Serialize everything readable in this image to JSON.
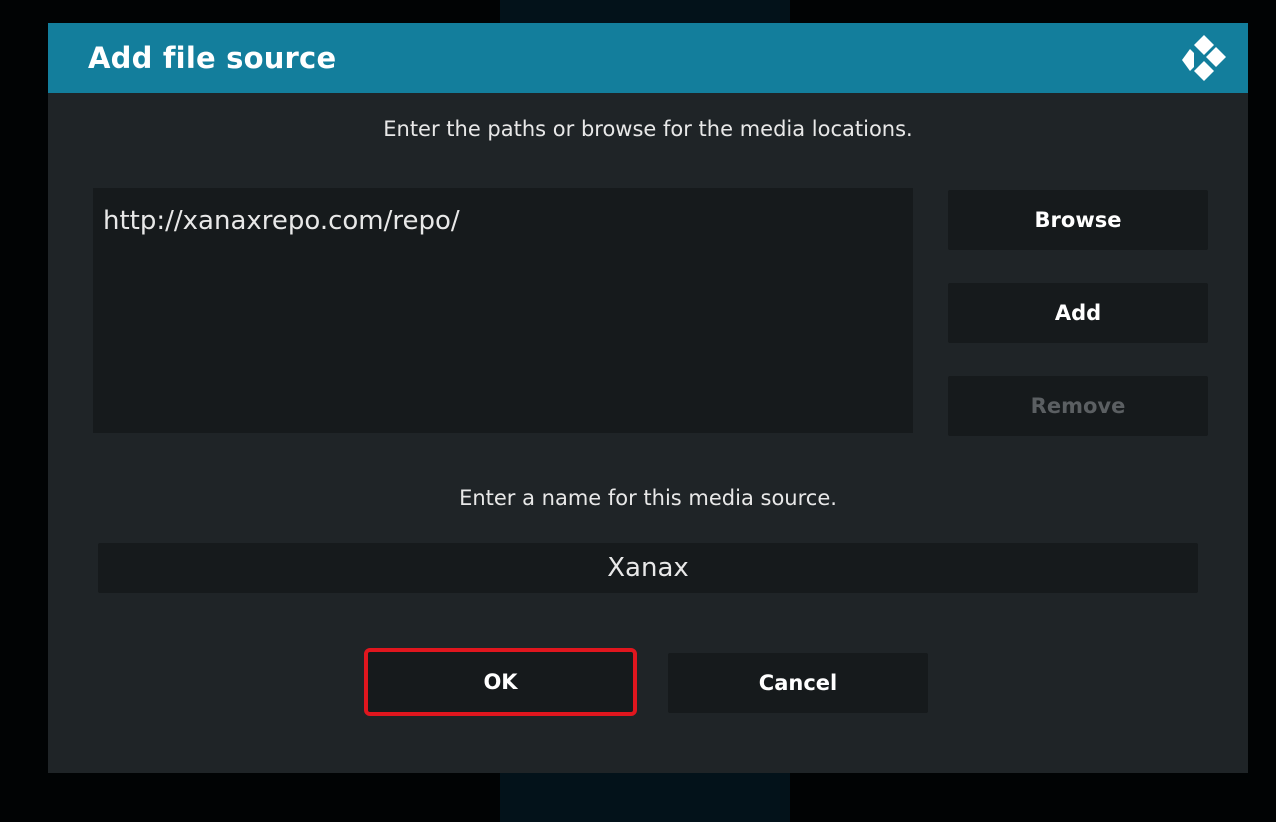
{
  "dialog": {
    "title": "Add file source",
    "logo_icon": "kodi-logo-icon",
    "paths_instruction": "Enter the paths or browse for the media locations.",
    "paths": [
      "http://xanaxrepo.com/repo/"
    ],
    "buttons": {
      "browse": "Browse",
      "add": "Add",
      "remove": "Remove"
    },
    "name_instruction": "Enter a name for this media source.",
    "name_value": "Xanax",
    "ok_label": "OK",
    "cancel_label": "Cancel"
  },
  "colors": {
    "titlebar": "#137e9c",
    "dialog_bg": "#1f2427",
    "field_bg": "#161a1c",
    "highlight": "#e0161e",
    "disabled_text": "#5b5f62"
  }
}
